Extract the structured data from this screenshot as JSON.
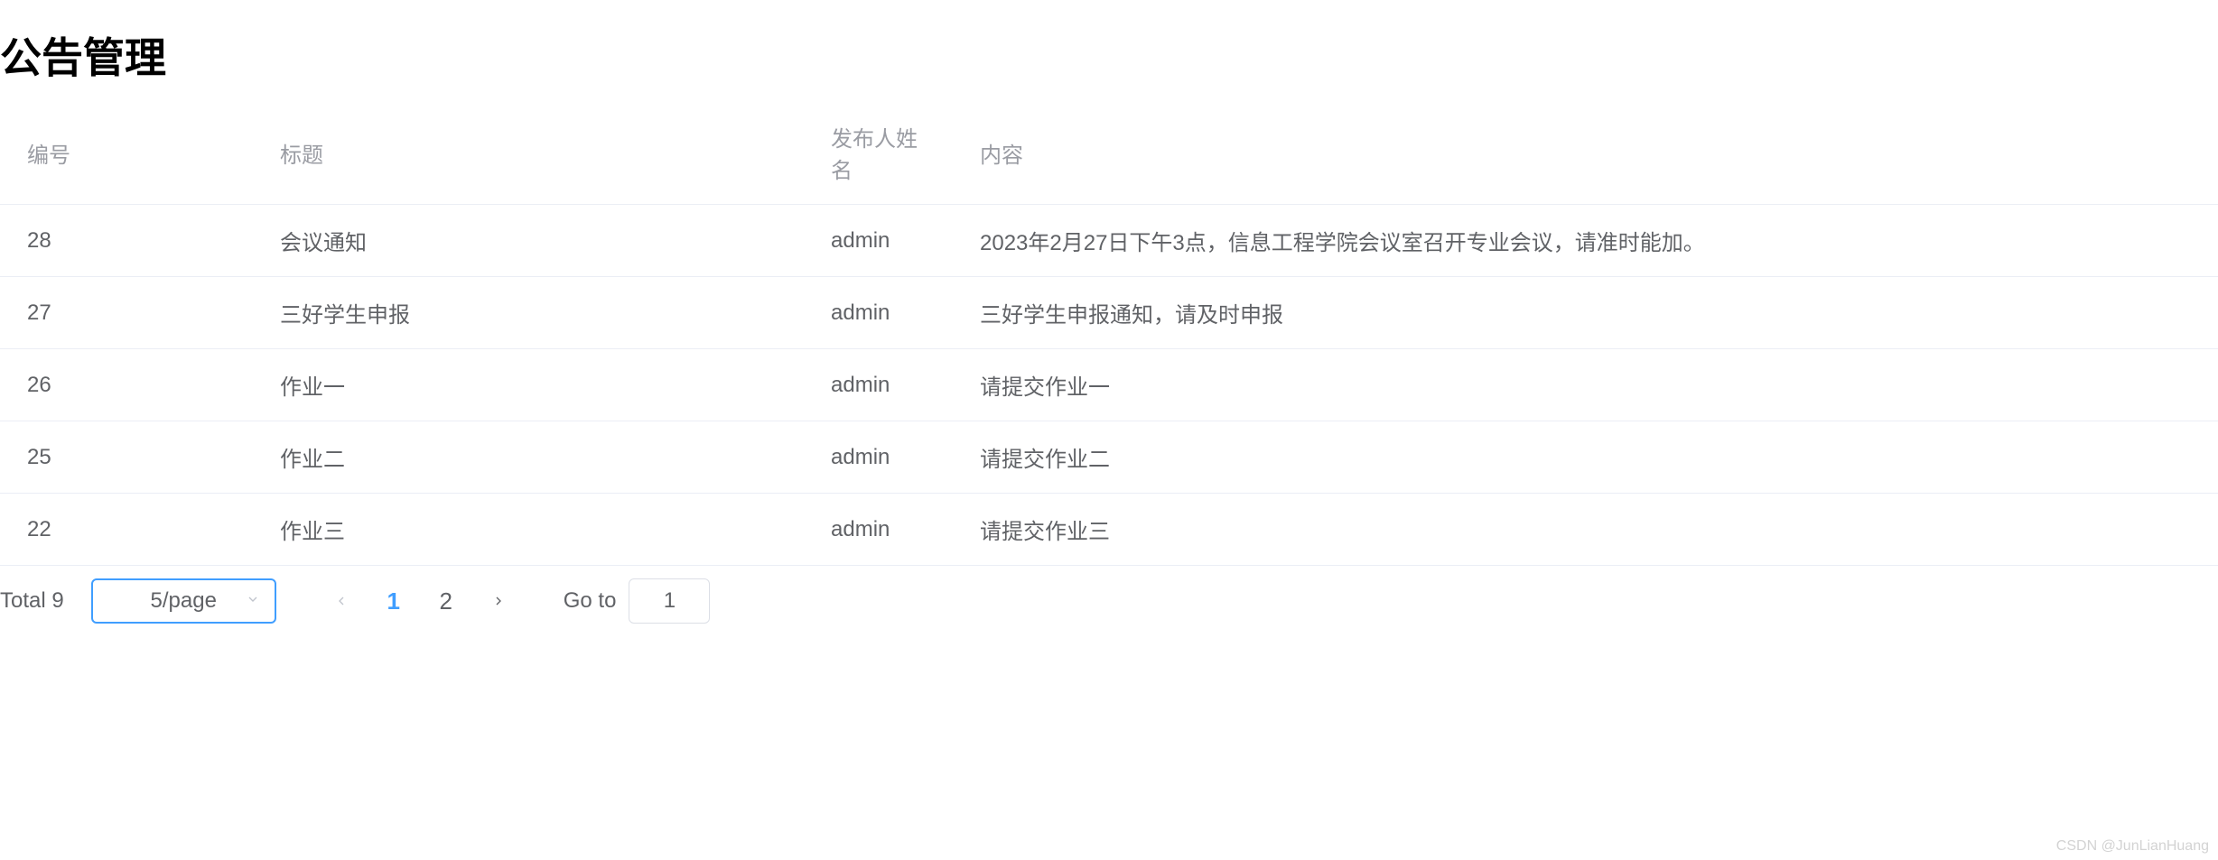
{
  "page": {
    "title": "公告管理"
  },
  "table": {
    "columns": {
      "id": "编号",
      "title": "标题",
      "publisher": "发布人姓名",
      "content": "内容"
    },
    "rows": [
      {
        "id": "28",
        "title": "会议通知",
        "publisher": "admin",
        "content": "2023年2月27日下午3点，信息工程学院会议室召开专业会议，请准时能加。"
      },
      {
        "id": "27",
        "title": "三好学生申报",
        "publisher": "admin",
        "content": "三好学生申报通知，请及时申报"
      },
      {
        "id": "26",
        "title": "作业一",
        "publisher": "admin",
        "content": "请提交作业一"
      },
      {
        "id": "25",
        "title": "作业二",
        "publisher": "admin",
        "content": "请提交作业二"
      },
      {
        "id": "22",
        "title": "作业三",
        "publisher": "admin",
        "content": "请提交作业三"
      }
    ]
  },
  "pagination": {
    "total_label": "Total 9",
    "page_size_label": "5/page",
    "pages": [
      "1",
      "2"
    ],
    "current_page": "1",
    "goto_label": "Go to",
    "goto_value": "1"
  },
  "watermark": "CSDN @JunLianHuang"
}
